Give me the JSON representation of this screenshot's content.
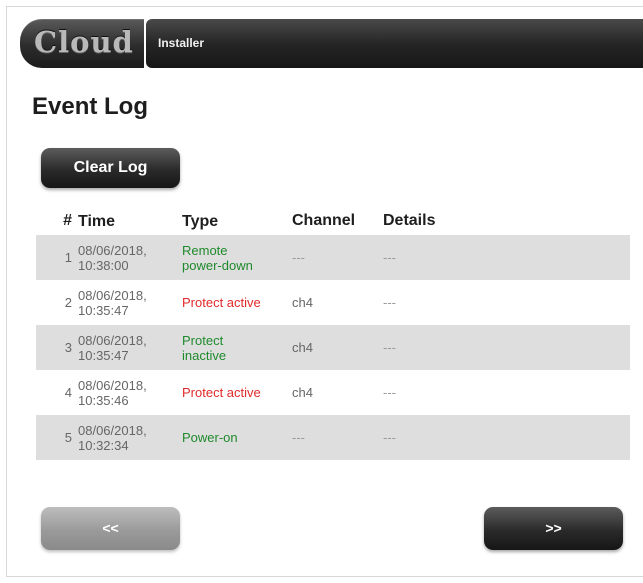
{
  "header": {
    "logo_text": "Cloud",
    "nav_label": "Installer"
  },
  "page": {
    "title": "Event Log"
  },
  "actions": {
    "clear_log": "Clear Log",
    "prev": "<<",
    "next": ">>"
  },
  "table": {
    "columns": {
      "num": "#",
      "time": "Time",
      "type": "Type",
      "channel": "Channel",
      "details": "Details"
    },
    "rows": [
      {
        "num": "1",
        "date": "08/06/2018,",
        "time": "10:38:00",
        "type_line1": "Remote",
        "type_line2": "power-down",
        "type_color": "#1f8a2c",
        "channel": "---",
        "details": "---"
      },
      {
        "num": "2",
        "date": "08/06/2018,",
        "time": "10:35:47",
        "type_line1": "Protect active",
        "type_line2": "",
        "type_color": "#e02a2a",
        "channel": "ch4",
        "details": "---"
      },
      {
        "num": "3",
        "date": "08/06/2018,",
        "time": "10:35:47",
        "type_line1": "Protect",
        "type_line2": "inactive",
        "type_color": "#1f8a2c",
        "channel": "ch4",
        "details": "---"
      },
      {
        "num": "4",
        "date": "08/06/2018,",
        "time": "10:35:46",
        "type_line1": "Protect active",
        "type_line2": "",
        "type_color": "#e02a2a",
        "channel": "ch4",
        "details": "---"
      },
      {
        "num": "5",
        "date": "08/06/2018,",
        "time": "10:32:34",
        "type_line1": "Power-on",
        "type_line2": "",
        "type_color": "#1f8a2c",
        "channel": "---",
        "details": "---"
      }
    ]
  }
}
